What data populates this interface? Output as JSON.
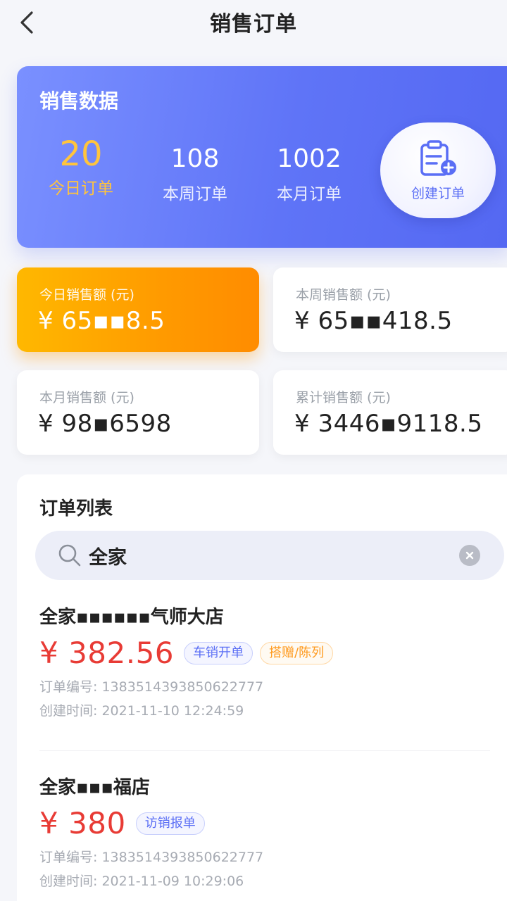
{
  "header": {
    "title": "销售订单",
    "back_icon": "chevron-left-icon"
  },
  "summary": {
    "title": "销售数据",
    "stats": [
      {
        "value": "20",
        "label": "今日订单"
      },
      {
        "value": "108",
        "label": "本周订单"
      },
      {
        "value": "1002",
        "label": "本月订单"
      }
    ],
    "create_button": {
      "label": "创建订单",
      "icon": "clipboard-add-icon"
    },
    "colors": {
      "banner": "#5f74f7",
      "highlight": "#ffc43d"
    }
  },
  "amounts": [
    {
      "label": "今日销售额 (元)",
      "value": "¥ 65▪▪8.5"
    },
    {
      "label": "本周销售额 (元)",
      "value": "¥ 65▪▪418.5"
    },
    {
      "label": "本月销售额 (元)",
      "value": "¥ 98▪6598"
    },
    {
      "label": "累计销售额 (元)",
      "value": "¥ 3446▪9118.5"
    }
  ],
  "order_list": {
    "title": "订单列表",
    "search": {
      "value": "全家",
      "placeholder": ""
    },
    "orders": [
      {
        "store": "全家▪▪▪▪▪▪气师大店",
        "price": "¥ 382.56",
        "tags": [
          "车销开单",
          "搭赠/陈列"
        ],
        "order_no_label": "订单编号:",
        "order_no": "1383514393850622777",
        "created_label": "创建时间:",
        "created": "2021-11-10 12:24:59"
      },
      {
        "store": "全家▪▪▪福店",
        "price": "¥ 380",
        "tags": [
          "访销报单"
        ],
        "order_no_label": "订单编号:",
        "order_no": "1383514393850622777",
        "created_label": "创建时间:",
        "created": "2021-11-09 10:29:06"
      }
    ]
  },
  "colors": {
    "price": "#e83b35",
    "accent": "#5a6ef5",
    "orange": "#ff9a00"
  }
}
